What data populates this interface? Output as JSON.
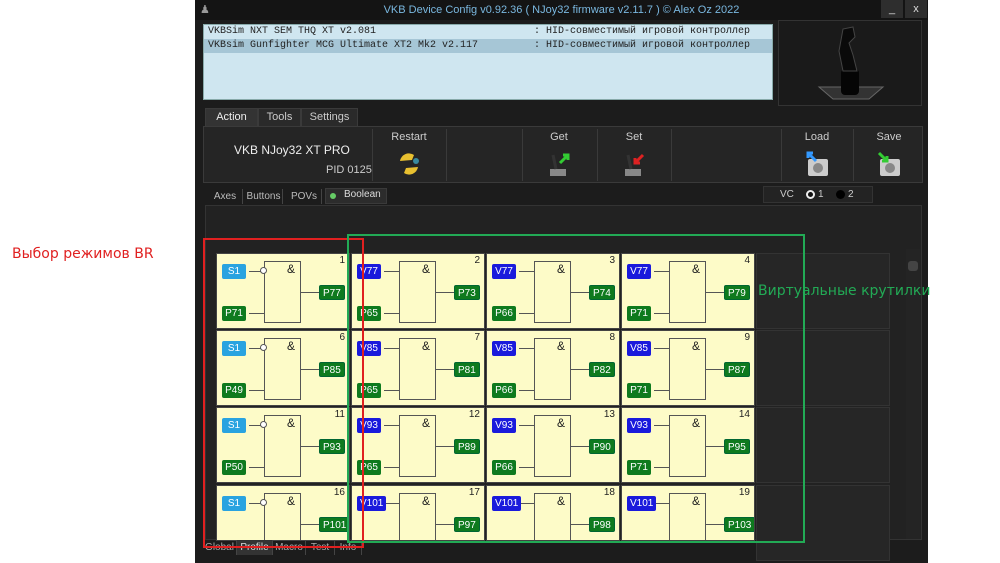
{
  "window": {
    "title": "VKB Device Config v0.92.36 ( NJoy32 firmware v2.11.7 ) © Alex Oz 2022",
    "minimize": "_",
    "close": "x"
  },
  "devices": [
    {
      "name": "VKBSim NXT SEM THQ XT v2.081",
      "type": ": HID-совместимый игровой контроллер"
    },
    {
      "name": "VKBsim Gunfighter MCG Ultimate XT2 Mk2 v2.117",
      "type": ": HID-совместимый игровой контроллер"
    }
  ],
  "tabs": [
    "Action",
    "Tools",
    "Settings"
  ],
  "toolbar": {
    "device_name": "VKB NJoy32 XT PRO",
    "pid": "PID 0125",
    "restart": "Restart",
    "get": "Get",
    "set": "Set",
    "load": "Load",
    "save": "Save"
  },
  "subtabs": [
    "Axes",
    "Buttons",
    "POVs",
    "Boolean"
  ],
  "vc": {
    "label": "VC",
    "opt1": "1",
    "opt2": "2",
    "selected": "1"
  },
  "colors": {
    "s": "#29a3e0",
    "v": "#1a1adc",
    "p": "#0e7a1e"
  },
  "cells": [
    {
      "n": "1",
      "a": "S1",
      "b": "P71",
      "out": "P77"
    },
    {
      "n": "2",
      "a": "V77",
      "b": "P65",
      "out": "P73"
    },
    {
      "n": "3",
      "a": "V77",
      "b": "P66",
      "out": "P74"
    },
    {
      "n": "4",
      "a": "V77",
      "b": "P71",
      "out": "P79"
    },
    {
      "n": "6",
      "a": "S1",
      "b": "P49",
      "out": "P85"
    },
    {
      "n": "7",
      "a": "V85",
      "b": "P65",
      "out": "P81"
    },
    {
      "n": "8",
      "a": "V85",
      "b": "P66",
      "out": "P82"
    },
    {
      "n": "9",
      "a": "V85",
      "b": "P71",
      "out": "P87"
    },
    {
      "n": "11",
      "a": "S1",
      "b": "P50",
      "out": "P93"
    },
    {
      "n": "12",
      "a": "V93",
      "b": "P65",
      "out": "P89"
    },
    {
      "n": "13",
      "a": "V93",
      "b": "P66",
      "out": "P90"
    },
    {
      "n": "14",
      "a": "V93",
      "b": "P71",
      "out": "P95"
    },
    {
      "n": "16",
      "a": "S1",
      "b": "",
      "out": "P101"
    },
    {
      "n": "17",
      "a": "V101",
      "b": "",
      "out": "P97"
    },
    {
      "n": "18",
      "a": "V101",
      "b": "",
      "out": "P98"
    },
    {
      "n": "19",
      "a": "V101",
      "b": "",
      "out": "P103"
    }
  ],
  "gate_symbol": "&",
  "bottom_tabs": [
    "Global",
    "Profile",
    "Macro",
    "Test",
    "Info"
  ],
  "annotations": {
    "red": "Выбор режимов BR",
    "green": "Виртуальные крутилки"
  }
}
